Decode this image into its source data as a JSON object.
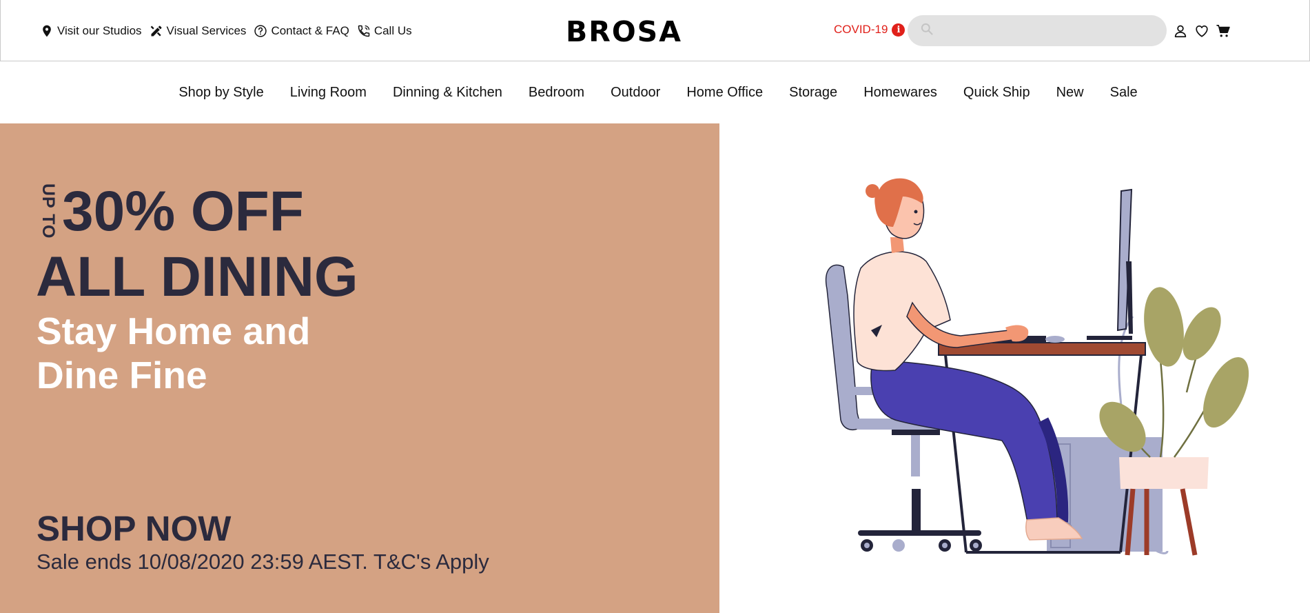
{
  "header": {
    "util_links": [
      {
        "label": "Visit our Studios",
        "icon": "map-pin-icon"
      },
      {
        "label": "Visual Services",
        "icon": "design-tools-icon"
      },
      {
        "label": "Contact & FAQ",
        "icon": "question-circle-icon"
      },
      {
        "label": "Call Us",
        "icon": "phone-icon"
      }
    ],
    "logo": "BROSA",
    "covid_label": "COVID-19",
    "covid_badge": "i",
    "search_placeholder": "",
    "account_icons": [
      "user-icon",
      "heart-icon",
      "cart-icon"
    ]
  },
  "nav": {
    "items": [
      "Shop by Style",
      "Living Room",
      "Dinning & Kitchen",
      "Bedroom",
      "Outdoor",
      "Home Office",
      "Storage",
      "Homewares",
      "Quick Ship",
      "New",
      "Sale"
    ]
  },
  "hero": {
    "upto": "UP TO",
    "headline_line1": "30% OFF",
    "headline_line2": "ALL DINING",
    "subline": "Stay Home and Dine Fine",
    "cta": "SHOP NOW",
    "terms": "Sale ends 10/08/2020 23:59 AEST. T&C's Apply",
    "background_color": "#d4a283",
    "text_dark_color": "#2b2a3d",
    "illustration": "woman-at-desk-illustration"
  },
  "colors": {
    "accent_red": "#e0201a",
    "search_bg": "#e2e2e2"
  }
}
